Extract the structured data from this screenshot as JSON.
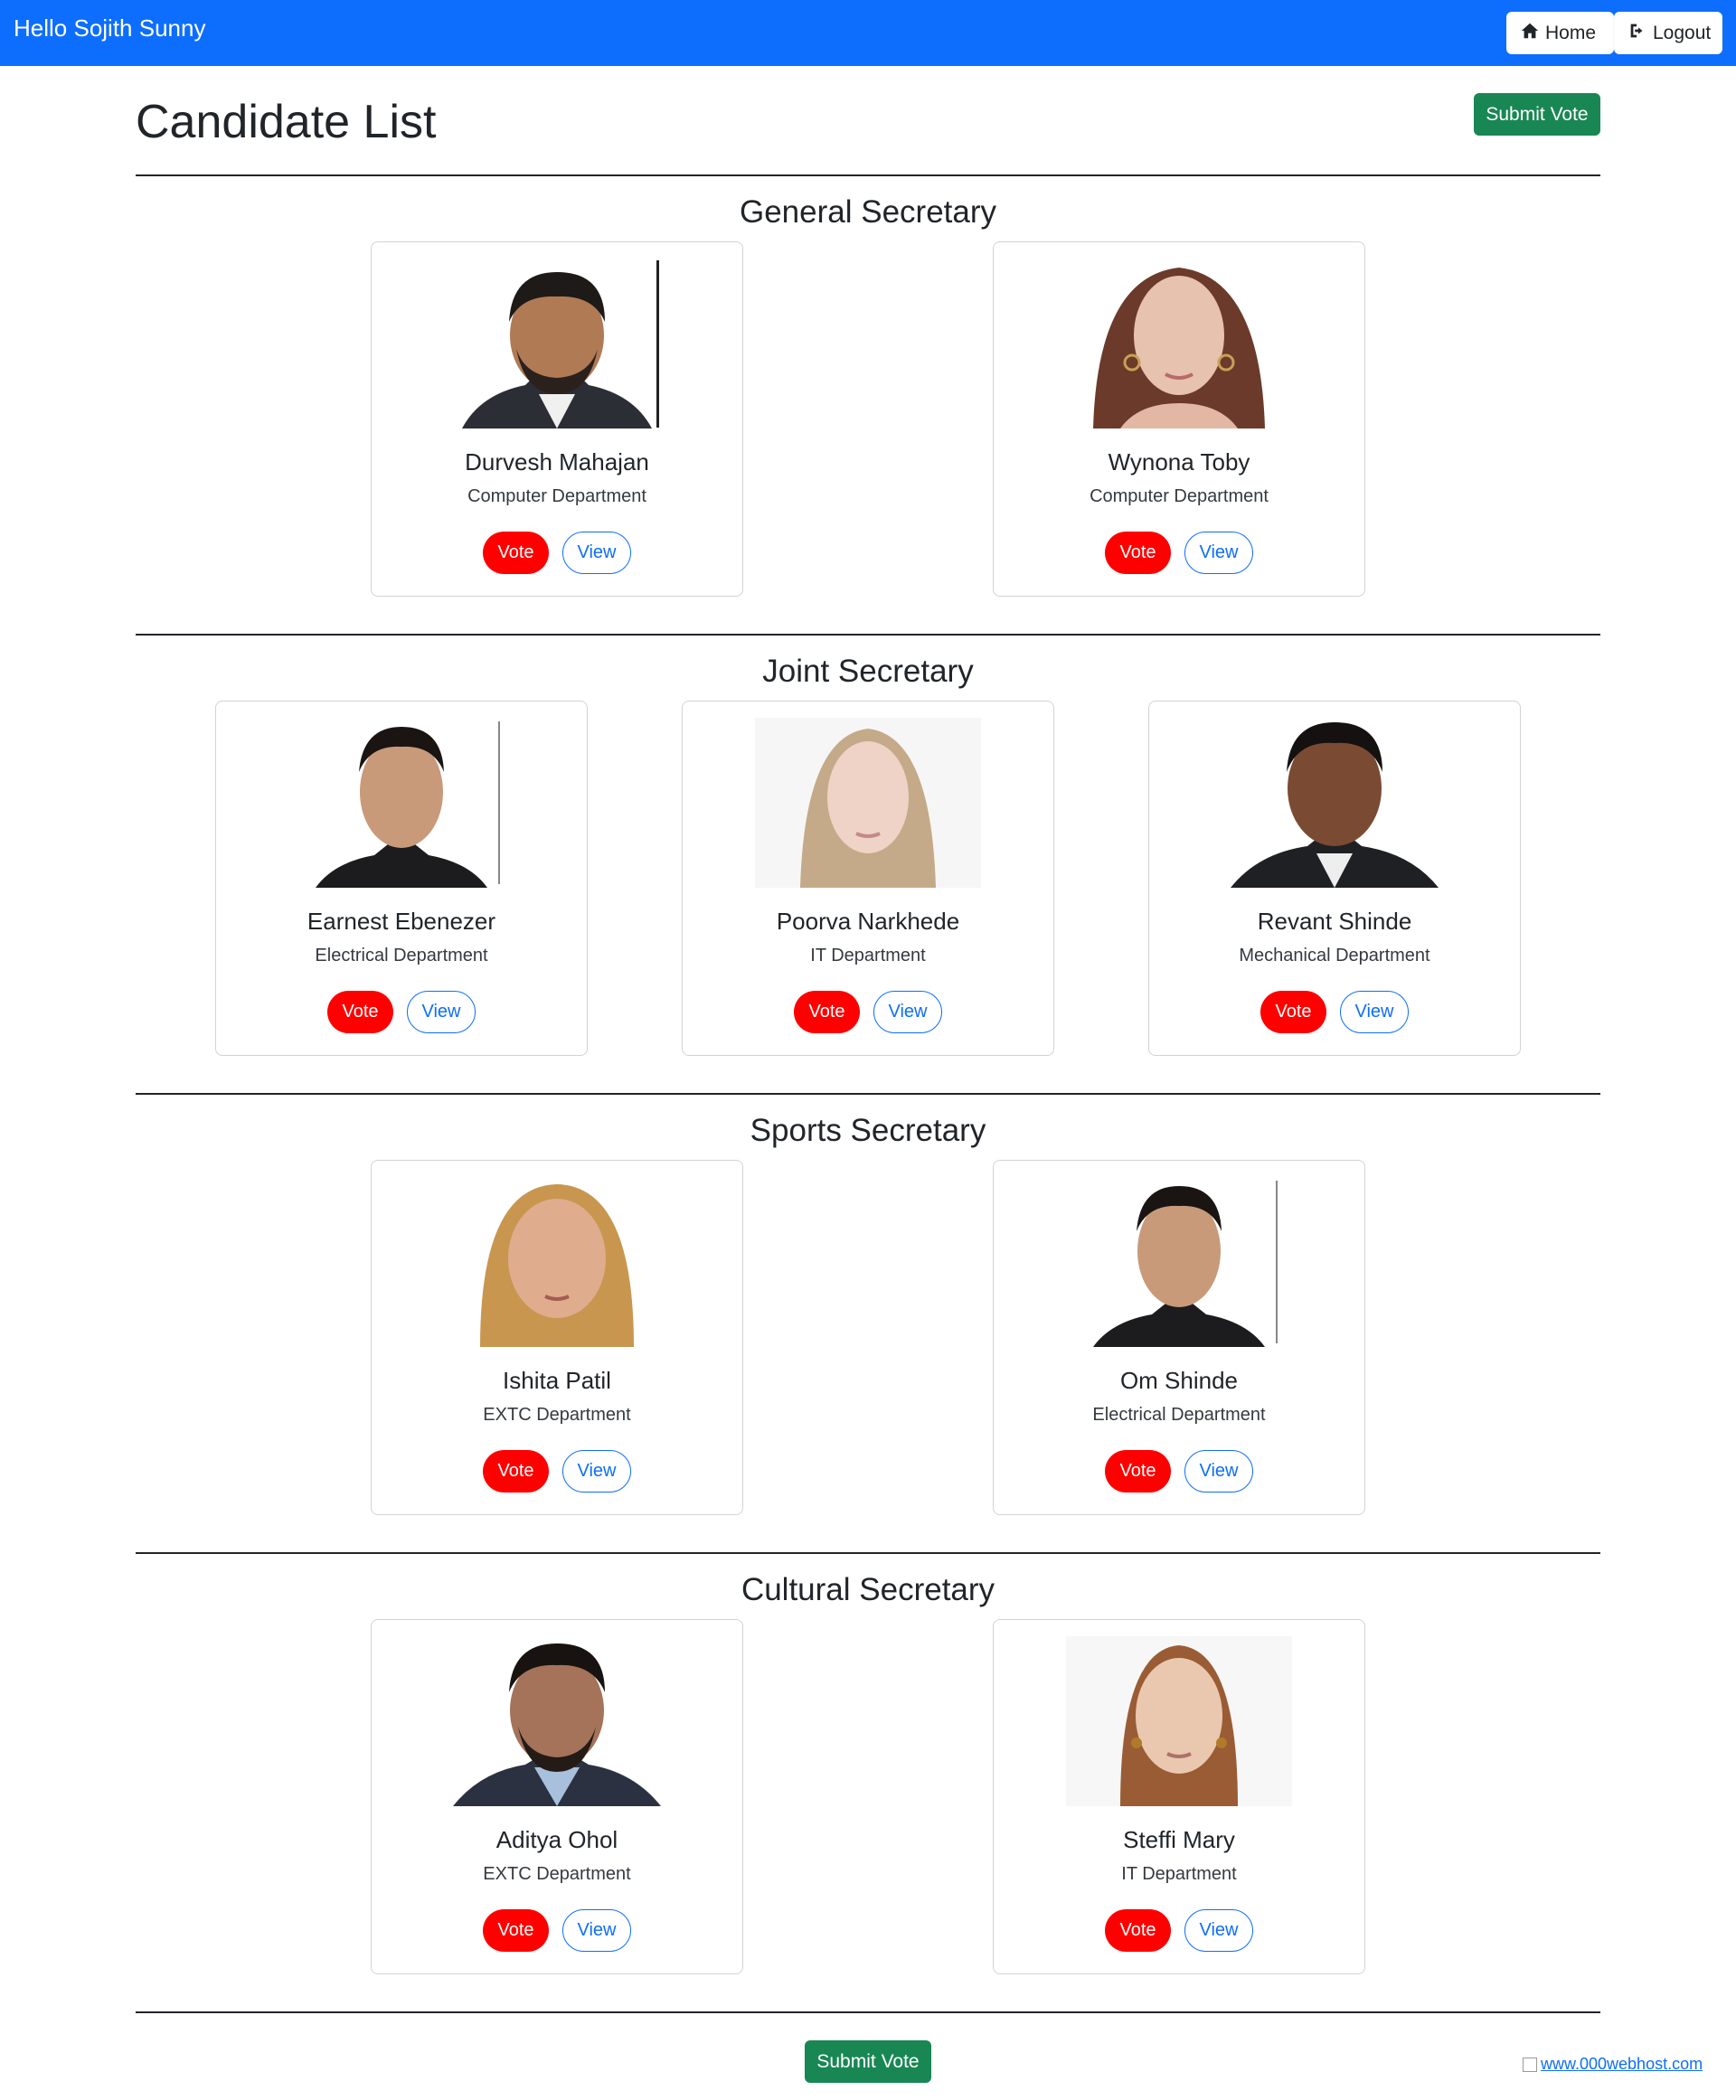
{
  "navbar": {
    "greeting": "Hello Sojith Sunny",
    "home_label": "Home",
    "logout_label": "Logout"
  },
  "page": {
    "title": "Candidate List",
    "submit_label": "Submit Vote"
  },
  "sections": [
    {
      "title": "General Secretary",
      "candidates": [
        {
          "name": "Durvesh Mahajan",
          "department": "Computer Department",
          "vote_label": "Vote",
          "view_label": "View"
        },
        {
          "name": "Wynona Toby",
          "department": "Computer Department",
          "vote_label": "Vote",
          "view_label": "View"
        }
      ]
    },
    {
      "title": "Joint Secretary",
      "candidates": [
        {
          "name": "Earnest Ebenezer",
          "department": "Electrical Department",
          "vote_label": "Vote",
          "view_label": "View"
        },
        {
          "name": "Poorva Narkhede",
          "department": "IT Department",
          "vote_label": "Vote",
          "view_label": "View"
        },
        {
          "name": "Revant Shinde",
          "department": "Mechanical Department",
          "vote_label": "Vote",
          "view_label": "View"
        }
      ]
    },
    {
      "title": "Sports Secretary",
      "candidates": [
        {
          "name": "Ishita Patil",
          "department": "EXTC Department",
          "vote_label": "Vote",
          "view_label": "View"
        },
        {
          "name": "Om Shinde",
          "department": "Electrical Department",
          "vote_label": "Vote",
          "view_label": "View"
        }
      ]
    },
    {
      "title": "Cultural Secretary",
      "candidates": [
        {
          "name": "Aditya Ohol",
          "department": "EXTC Department",
          "vote_label": "Vote",
          "view_label": "View"
        },
        {
          "name": "Steffi Mary",
          "department": "IT Department",
          "vote_label": "Vote",
          "view_label": "View"
        }
      ]
    }
  ],
  "footer": {
    "link_text": "www.000webhost.com"
  },
  "colors": {
    "navbar": "#0d6efd",
    "submit": "#198754",
    "vote": "#ff0000",
    "view": "#0d6efd"
  },
  "icons": {
    "home": "home-icon",
    "logout": "logout-icon"
  }
}
